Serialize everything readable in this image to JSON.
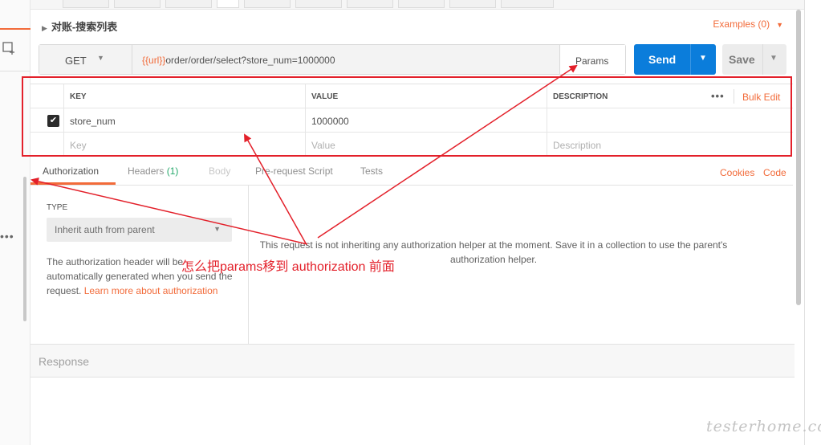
{
  "request": {
    "name": "对账-搜索列表",
    "examples": "Examples (0)",
    "method": "GET",
    "url_var": "{{url}}",
    "url_path": "order/order/select?store_num=1000000",
    "params_label": "Params",
    "send_label": "Send",
    "save_label": "Save"
  },
  "params_table": {
    "headers": {
      "key": "KEY",
      "value": "VALUE",
      "description": "DESCRIPTION"
    },
    "more_label": "•••",
    "bulk_edit": "Bulk Edit",
    "rows": [
      {
        "checked": true,
        "key": "store_num",
        "value": "1000000",
        "description": ""
      }
    ],
    "placeholders": {
      "key": "Key",
      "value": "Value",
      "description": "Description"
    }
  },
  "tabs": [
    {
      "label": "Authorization",
      "state": "active"
    },
    {
      "label": "Headers",
      "count": "(1)",
      "state": "normal"
    },
    {
      "label": "Body",
      "state": "disabled"
    },
    {
      "label": "Pre-request Script",
      "state": "normal"
    },
    {
      "label": "Tests",
      "state": "normal"
    }
  ],
  "right_links": {
    "cookies": "Cookies",
    "code": "Code"
  },
  "auth": {
    "type_label": "TYPE",
    "type_value": "Inherit auth from parent",
    "desc_text": "The authorization header will be automatically generated when you send the request.",
    "desc_link": "Learn more about authorization",
    "message": "This request is not inheriting any authorization helper at the moment. Save it in a collection to use the parent's authorization helper."
  },
  "annotation": "怎么把params移到 authorization 前面",
  "response_label": "Response",
  "watermark": "testerhome.com",
  "colors": {
    "accent": "#f26b3a",
    "send": "#0b7ddb",
    "annotation": "#e3202a"
  }
}
